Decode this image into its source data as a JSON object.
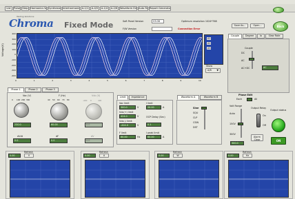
{
  "toolbar": {
    "buttons": [
      "List",
      "Pulse",
      "Step",
      "Harmonics Wave",
      "Synthesize",
      "Interharmonics",
      "A-1/1",
      "A-4/5",
      "A-1/4",
      "A-2/6",
      "Waveform Editor",
      "Auto Run",
      "Report Generator"
    ],
    "power_icon": "power-icon"
  },
  "header": {
    "logo_tagline": "Testing Solutions",
    "logo_text": "Chroma",
    "mode_title": "Fixed Mode",
    "soft_panel_version_label": "Soft Panel Version",
    "soft_panel_version_value": "V3.08",
    "fw_version_label": "F/W Version",
    "fw_version_value": "",
    "optimum_resolution": "Optimum resolution 1024*768",
    "connection_status": "Connection Error",
    "save_as_label": "Save As...",
    "open_label": "Open...",
    "back_label": "Back"
  },
  "main_scope": {
    "y_axis_label": "Voltage(V)",
    "y_ticks": [
      "400",
      "300",
      "200",
      "100",
      "0",
      "-100",
      "-200",
      "-300",
      "-400"
    ],
    "x_ticks": [
      "0",
      "1",
      "2",
      "3",
      "4",
      "5",
      "6",
      "7",
      "8",
      "9",
      "10"
    ],
    "channel_labels": [
      "A1",
      "A2",
      "A3"
    ],
    "show_label": "Show",
    "show_value": "A/B"
  },
  "coupling_panel": {
    "tabs": [
      "Couple",
      "Degree",
      "Io",
      "Slew Rate"
    ],
    "group_label": "Couple",
    "options": [
      "DC",
      "AC",
      "AC+DC"
    ],
    "value": "AC"
  },
  "phase_tabs": [
    "Phase 1",
    "Phase 2",
    "Phase 3"
  ],
  "phase_controls": {
    "vac_label": "Vac (V)",
    "vac_value": "230.0",
    "vac_scale": [
      "0",
      "100",
      "200",
      "300"
    ],
    "freq_label": "F (Hz)",
    "freq_value": "60.00",
    "freq_scale": [
      "40",
      "50",
      "60",
      "70",
      "80"
    ],
    "dc_label": "Vdc (V)",
    "dc_value": "0.0",
    "dc_scale": [
      "-400",
      "0",
      "400"
    ],
    "knob1_field_label": "dVdt",
    "knob1_field_value": "0.0",
    "knob2_field_label": "dF",
    "knob2_field_value": "0.0",
    "knob3_field_label": "dV",
    "knob3_field_value": "0.0"
  },
  "limit_panel": {
    "tabs": [
      "Limit",
      "Impedance"
    ],
    "vac_limit_label": "Vac limit",
    "vac_limit_value": "300.0",
    "vdc_plus_label": "Vdc(+) limit",
    "vdc_plus_value": "424.0",
    "vdc_minus_label": "Vdc(-) limit",
    "vdc_minus_value": "-424.0",
    "f_limit_label": "F limit",
    "f_limit_value": "80.00",
    "i_limit_label": "I limit",
    "i_limit_value": "20.00",
    "ocp_delay_label": "OCP Delay (Sec)",
    "ocp_delay_value": "0.1",
    "ipeak_label": "I peak limit",
    "ipeak_value": "60.00",
    "unit_v": "V",
    "unit_hz": "Hz",
    "unit_a": "A"
  },
  "waveform_panel": {
    "tabs": [
      "Waveform A",
      "Waveform B"
    ],
    "list": [
      "Sine",
      "SQU",
      "CLP",
      "CSIN",
      "DST"
    ],
    "selected": "Sine"
  },
  "right_controls": {
    "phase_edit_label": "Phase Edit",
    "phase_edit_options": [
      "Each",
      "All"
    ],
    "volt_range_label": "Volt Range",
    "volt_range_options": [
      "Auto",
      "150V",
      "300V"
    ],
    "output_relay_label": "Output Relay",
    "relay_on": "On",
    "relay_off": "Off",
    "output_status_label": "Output status",
    "on_button": "ON",
    "alarm_clear_label": "Alarm Clear",
    "volt_field_value": "300.0"
  },
  "meters": [
    {
      "refresh_label": "Refresh",
      "field_value": "0.00",
      "unit": "V"
    },
    {
      "refresh_label": "Refresh",
      "field_value": "0.00",
      "unit": "A"
    },
    {
      "refresh_label": "Refresh",
      "field_value": "0.00",
      "unit": "W"
    },
    {
      "refresh_label": "Refresh",
      "field_value": "0.00",
      "unit": "Hz"
    }
  ]
}
